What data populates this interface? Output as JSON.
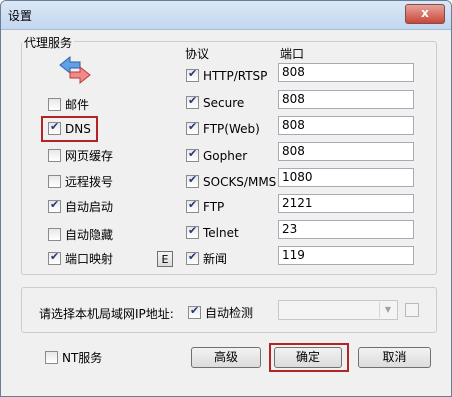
{
  "window": {
    "title": "设置",
    "close_symbol": "x"
  },
  "proxy_group": {
    "label": "代理服务",
    "protocol_header": "协议",
    "port_header": "端口"
  },
  "left_options": [
    {
      "label": "邮件",
      "checked": false
    },
    {
      "label": "DNS",
      "checked": true
    },
    {
      "label": "网页缓存",
      "checked": false
    },
    {
      "label": "远程拨号",
      "checked": false
    },
    {
      "label": "自动启动",
      "checked": true
    },
    {
      "label": "自动隐藏",
      "checked": false
    },
    {
      "label": "端口映射",
      "checked": true
    }
  ],
  "e_button_label": "E",
  "protocols": [
    {
      "label": "HTTP/RTSP",
      "checked": true,
      "port": "808"
    },
    {
      "label": "Secure",
      "checked": true,
      "port": "808"
    },
    {
      "label": "FTP(Web)",
      "checked": true,
      "port": "808"
    },
    {
      "label": "Gopher",
      "checked": true,
      "port": "808"
    },
    {
      "label": "SOCKS/MMS",
      "checked": true,
      "port": "1080"
    },
    {
      "label": "FTP",
      "checked": true,
      "port": "2121"
    },
    {
      "label": "Telnet",
      "checked": true,
      "port": "23"
    },
    {
      "label": "新闻",
      "checked": true,
      "port": "119"
    }
  ],
  "lan_ip": {
    "label": "请选择本机局域网IP地址:",
    "auto_detect_label": "自动检测",
    "auto_detect_checked": true,
    "value": ""
  },
  "footer": {
    "nt_service_label": "NT服务",
    "advanced_label": "高级",
    "ok_label": "确定",
    "cancel_label": "取消"
  },
  "colors": {
    "highlight": "#b32525",
    "check": "#23387a",
    "titlebar": "#c3d7ef"
  }
}
